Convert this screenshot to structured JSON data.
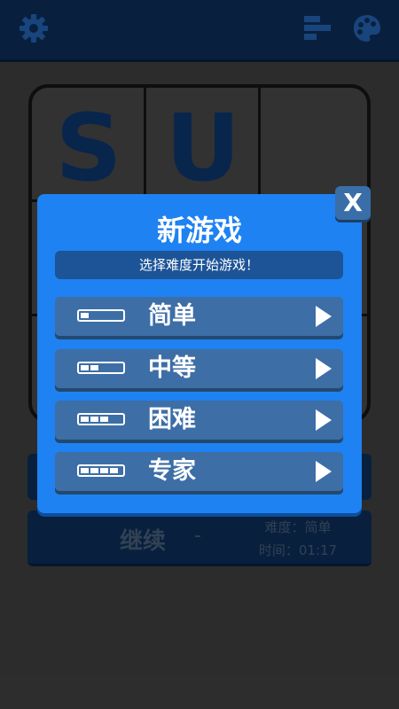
{
  "modal": {
    "title": "新游戏",
    "subtitle": "选择难度开始游戏！",
    "close_label": "X",
    "options": [
      {
        "label": "简单",
        "level": 1
      },
      {
        "label": "中等",
        "level": 2
      },
      {
        "label": "困难",
        "level": 3
      },
      {
        "label": "专家",
        "level": 4
      }
    ]
  },
  "board": {
    "letters": [
      "S",
      "U"
    ]
  },
  "continue": {
    "label": "继续",
    "separator": "-",
    "difficulty_text": "难度：简单",
    "time_text": "时间：01:17"
  },
  "icons": {
    "settings": "gear-icon",
    "stats": "stats-icon",
    "theme": "palette-icon",
    "difficulty_meter": "difficulty-meter-icon",
    "play": "play-arrow-icon"
  },
  "colors": {
    "background": "#333333",
    "topbar": "#0a2547",
    "modal": "#1e82f2",
    "option": "#3d6ea6",
    "subtitle_bar": "#1c5497"
  }
}
